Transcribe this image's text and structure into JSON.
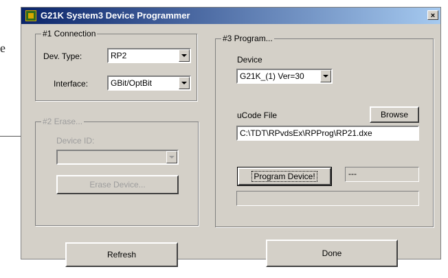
{
  "background": {
    "doc_text": "e"
  },
  "window": {
    "title": "G21K  System3 Device Programmer",
    "close_label": "×"
  },
  "connection": {
    "group_label": "#1 Connection",
    "dev_type_label": "Dev. Type:",
    "dev_type_value": "RP2",
    "interface_label": "Interface:",
    "interface_value": "GBit/OptBit"
  },
  "erase": {
    "group_label": "#2 Erase...",
    "device_id_label": "Device ID:",
    "device_id_value": "",
    "erase_button": "Erase Device..."
  },
  "program": {
    "group_label": "#3 Program...",
    "device_label": "Device",
    "device_value": "G21K_(1)  Ver=30",
    "ucode_label": "uCode File",
    "browse_button": "Browse",
    "ucode_path": "C:\\TDT\\RPvdsEx\\RPProg\\RP21.dxe",
    "program_button": "Program Device!",
    "status_text": "---",
    "progress_percent": 0
  },
  "footer": {
    "refresh_button": "Refresh",
    "done_button": "Done"
  },
  "colors": {
    "face": "#d4d0c8",
    "title_start": "#0a246a",
    "title_end": "#a6caf0",
    "disabled_text": "#9c9c9c"
  }
}
